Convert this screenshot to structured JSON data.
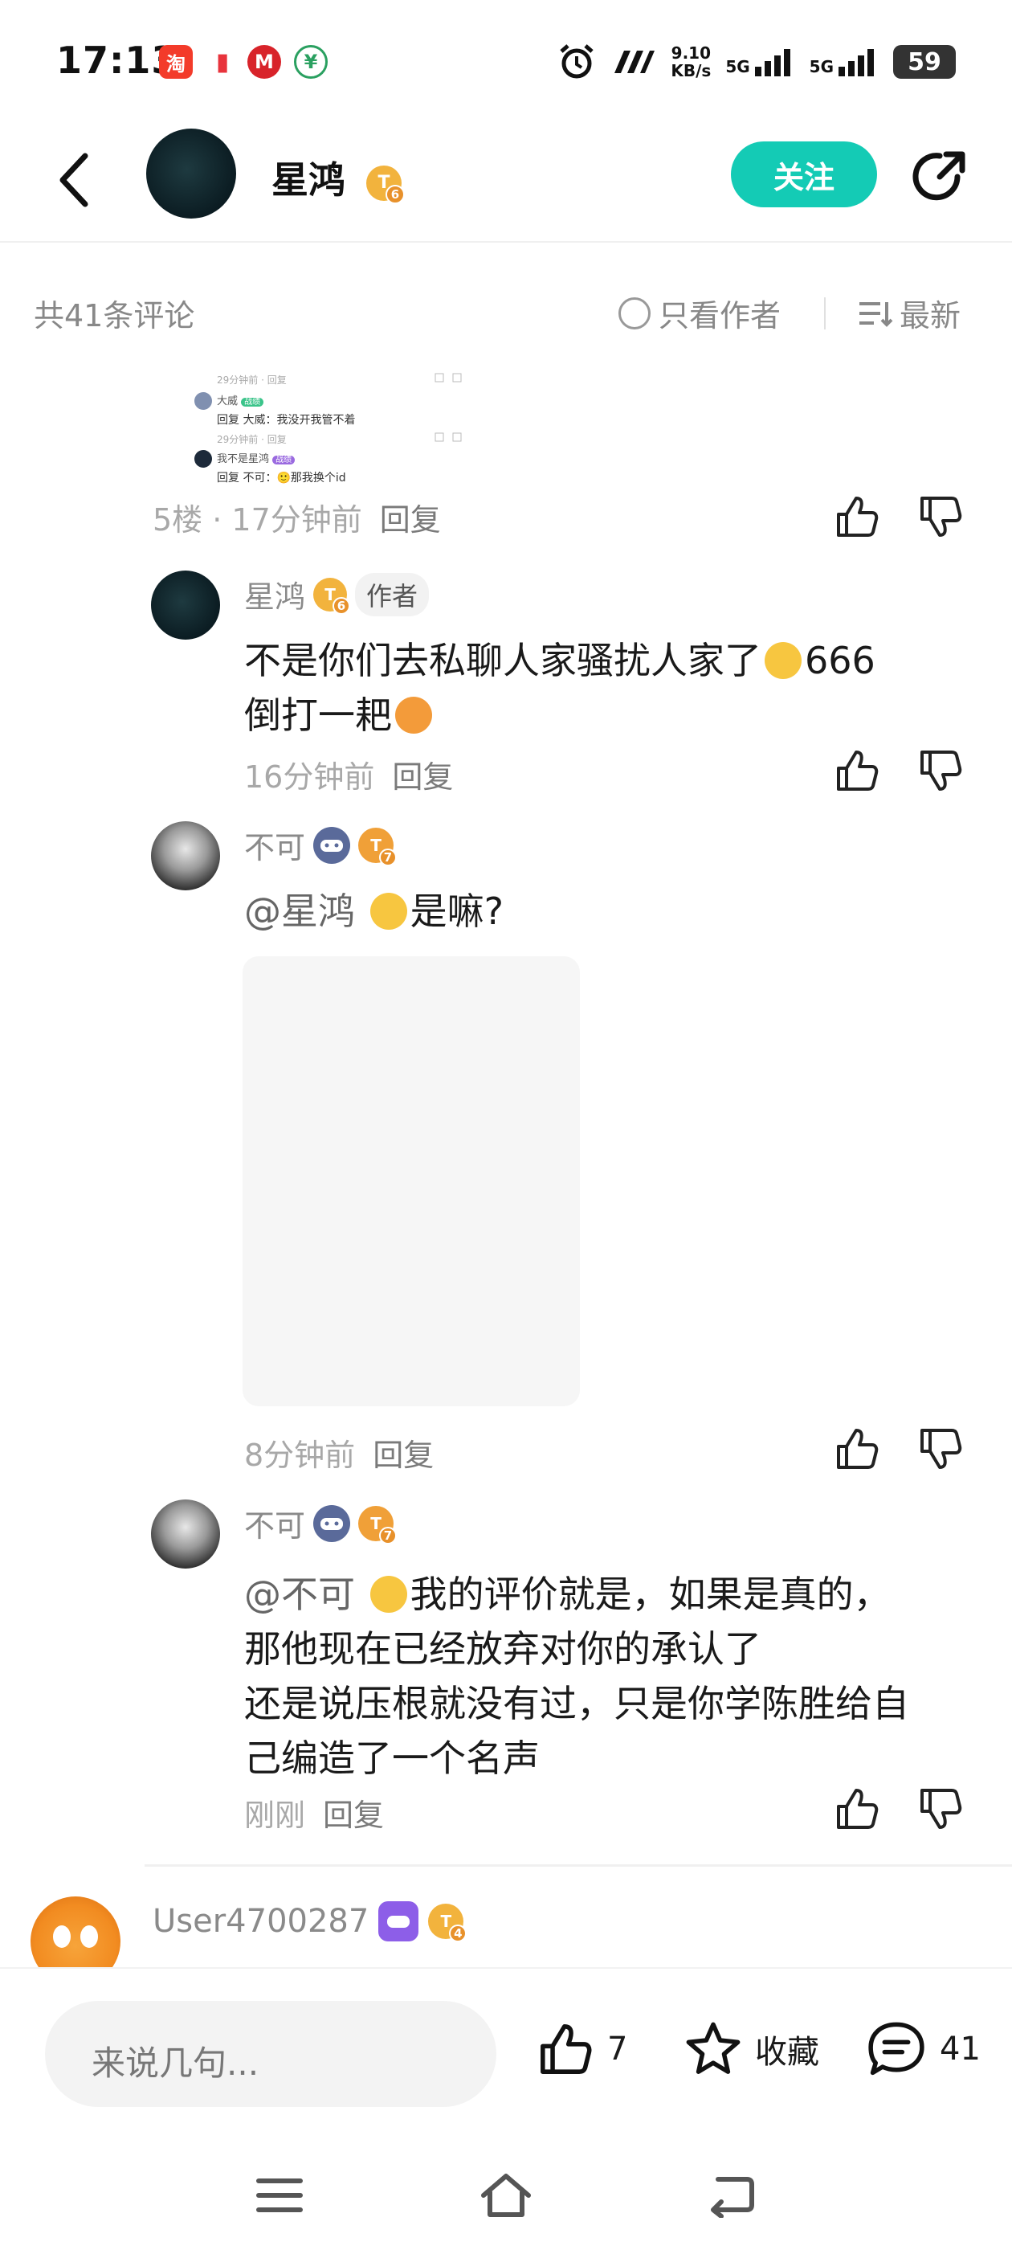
{
  "status_bar": {
    "time": "17:13",
    "apps": [
      {
        "name": "taobao",
        "label": "淘",
        "color": "#f33b2a"
      },
      {
        "name": "red-app",
        "label": "▮",
        "color": "#e8333c"
      },
      {
        "name": "metro",
        "label": "M",
        "color": "#d8232a"
      },
      {
        "name": "green-app",
        "label": "¥",
        "color": "#2aa060"
      }
    ],
    "speed": "9.10",
    "speed_unit": "KB/s",
    "net1": "5G",
    "net2": "5G",
    "battery": "59"
  },
  "header": {
    "name": "星鸿",
    "level": "6",
    "follow_label": "关注"
  },
  "filter": {
    "count_text": "共41条评论",
    "author_only": "只看作者",
    "sort": "最新"
  },
  "thumb_image": {
    "line1_time": "29分钟前 · 回复",
    "line2_name": "大威",
    "line2_tag": "战绩",
    "line3": "回复 大威：我没开我管不着",
    "line4_time": "29分钟前 · 回复",
    "line5_name": "我不是星鸿",
    "line5_tag": "战绩",
    "line6": "回复 不可：🙂那我换个id"
  },
  "comment_main": {
    "meta_floor": "5楼 · 17分钟前",
    "reply_label": "回复"
  },
  "replies": [
    {
      "author": "星鸿",
      "level": "6",
      "tag": "作者",
      "text_line1": "不是你们去私聊人家骚扰人家了",
      "text_line1_suffix": "666",
      "text_line2": "倒打一耙",
      "time": "16分钟前",
      "reply_label": "回复"
    },
    {
      "author": "不可",
      "level": "7",
      "mention": "@星鸿",
      "text": "是嘛?",
      "time": "8分钟前",
      "reply_label": "回复"
    },
    {
      "author": "不可",
      "level": "7",
      "mention": "@不可",
      "text_line1": "我的评价就是，如果是真的，",
      "text_line2": "那他现在已经放弃对你的承认了",
      "text_line3": "还是说压根就没有过，只是你学陈胜给自",
      "text_line4": "己编造了一个名声",
      "time": "刚刚",
      "reply_label": "回复"
    }
  ],
  "next_comment": {
    "author": "User4700287",
    "level": "4"
  },
  "bottom_bar": {
    "input_placeholder": "来说几句...",
    "like_count": "7",
    "collect_label": "收藏",
    "comment_count": "41"
  }
}
